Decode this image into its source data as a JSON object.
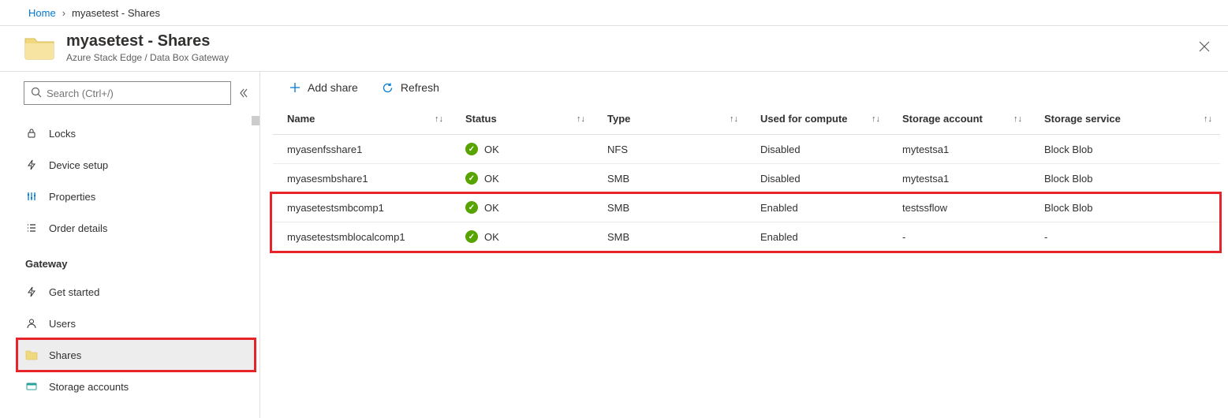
{
  "breadcrumb": {
    "home": "Home",
    "current": "myasetest - Shares"
  },
  "header": {
    "title": "myasetest - Shares",
    "subtitle": "Azure Stack Edge / Data Box Gateway"
  },
  "sidebar": {
    "search_placeholder": "Search (Ctrl+/)",
    "items_top": [
      {
        "icon": "lock",
        "label": "Locks"
      },
      {
        "icon": "bolt",
        "label": "Device setup"
      },
      {
        "icon": "sliders",
        "label": "Properties"
      },
      {
        "icon": "list",
        "label": "Order details"
      }
    ],
    "section_gateway": "Gateway",
    "items_gateway": [
      {
        "icon": "bolt",
        "label": "Get started"
      },
      {
        "icon": "user",
        "label": "Users"
      },
      {
        "icon": "folder",
        "label": "Shares",
        "selected": true
      },
      {
        "icon": "storage",
        "label": "Storage accounts"
      }
    ]
  },
  "toolbar": {
    "add_share": "Add share",
    "refresh": "Refresh"
  },
  "table": {
    "columns": {
      "name": "Name",
      "status": "Status",
      "type": "Type",
      "used": "Used for compute",
      "account": "Storage account",
      "service": "Storage service"
    },
    "rows": [
      {
        "name": "myasenfsshare1",
        "status": "OK",
        "type": "NFS",
        "used": "Disabled",
        "account": "mytestsa1",
        "service": "Block Blob"
      },
      {
        "name": "myasesmbshare1",
        "status": "OK",
        "type": "SMB",
        "used": "Disabled",
        "account": "mytestsa1",
        "service": "Block Blob"
      },
      {
        "name": "myasetestsmbcomp1",
        "status": "OK",
        "type": "SMB",
        "used": "Enabled",
        "account": "testssflow",
        "service": "Block Blob"
      },
      {
        "name": "myasetestsmblocalcomp1",
        "status": "OK",
        "type": "SMB",
        "used": "Enabled",
        "account": "-",
        "service": "-"
      }
    ]
  }
}
